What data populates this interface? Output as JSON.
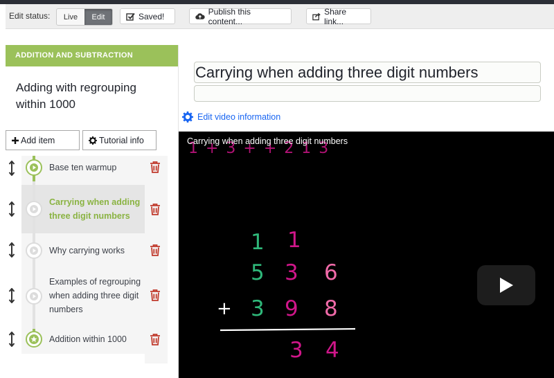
{
  "toolbar": {
    "edit_status_label": "Edit status:",
    "live_label": "Live",
    "edit_label": "Edit",
    "saved_label": "Saved!",
    "publish_label": "Publish this content...",
    "share_label": "Share link..."
  },
  "sidebar": {
    "section_label": "ADDITION AND SUBTRACTION",
    "tutorial_title": "Adding with regrouping within 1000",
    "add_item_label": "Add item",
    "tutorial_info_label": "Tutorial info",
    "items": [
      {
        "label": "Base ten warmup",
        "icon": "play-icon",
        "status": "done"
      },
      {
        "label": "Carrying when adding three digit numbers",
        "icon": "play-icon",
        "status": "selected"
      },
      {
        "label": "Why carrying works",
        "icon": "play-icon",
        "status": "todo"
      },
      {
        "label": "Examples of regrouping when adding three digit numbers",
        "icon": "play-icon",
        "status": "todo"
      },
      {
        "label": "Addition within 1000",
        "icon": "star-icon",
        "status": "done"
      }
    ]
  },
  "editor": {
    "video_title_value": "Carrying when adding three digit numbers",
    "description_value": "",
    "edit_video_info_label": "Edit video information"
  },
  "video": {
    "caption": "Carrying when adding three digit numbers",
    "top_scribble": "1 + 3  + +   2 1 3",
    "carry_1": "1",
    "carry_2": "1",
    "top_digits": [
      "5",
      "3",
      "6"
    ],
    "plus_sign": "+",
    "bottom_digits": [
      "3",
      "9",
      "8"
    ],
    "result_digits": [
      "3",
      "4"
    ]
  },
  "colors": {
    "brand_green": "#9bc15a",
    "link_blue": "#1865f2",
    "trash_red": "#c0392b",
    "ink_green": "#2fb87a",
    "ink_magenta": "#d0168a",
    "ink_pink": "#f06aa8"
  }
}
